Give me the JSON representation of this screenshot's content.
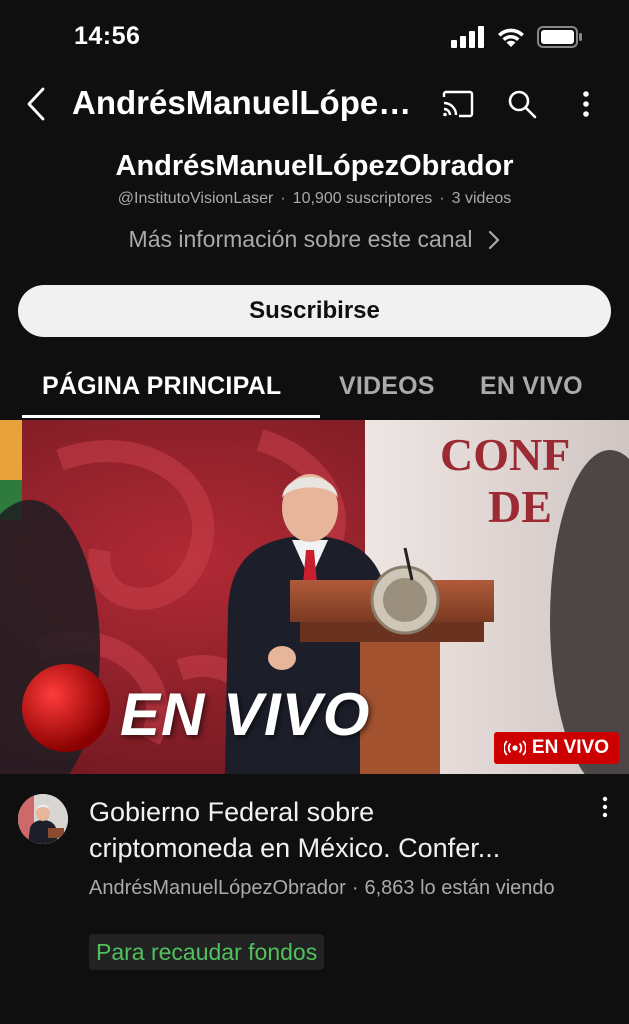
{
  "status_bar": {
    "time": "14:56"
  },
  "app_bar": {
    "title": "AndrésManuelLópezObrador"
  },
  "channel": {
    "name": "AndrésManuelLópezObrador",
    "handle": "@InstitutoVisionLaser",
    "subscribers": "10,900 suscriptores",
    "video_count": "3 videos",
    "separator": "·",
    "more_info": "Más información sobre este canal",
    "subscribe_label": "Suscribirse"
  },
  "tabs": [
    {
      "label": "PÁGINA PRINCIPAL",
      "active": true
    },
    {
      "label": "VIDEOS",
      "active": false
    },
    {
      "label": "EN VIVO",
      "active": false
    }
  ],
  "featured_video": {
    "thumbnail_text": "EN VIVO",
    "thumbnail_sign_line1": "CONF",
    "thumbnail_sign_line2": "DE",
    "live_badge": "EN VIVO",
    "title_line1": "Gobierno Federal sobre",
    "title_line2": "criptomoneda en México. Confer...",
    "channel": "AndrésManuelLópezObrador",
    "separator": "·",
    "viewers": "6,863 lo están viendo",
    "fundraiser_label": "Para recaudar fondos"
  },
  "colors": {
    "background": "#0f0f0f",
    "secondary_text": "#aaaaaa",
    "live_red": "#cc0000",
    "fundraiser_green": "#4fc15d"
  },
  "icons": [
    "cellular-signal-icon",
    "wifi-icon",
    "battery-icon",
    "back-arrow-icon",
    "cast-icon",
    "search-icon",
    "more-vert-icon",
    "live-broadcast-icon"
  ]
}
